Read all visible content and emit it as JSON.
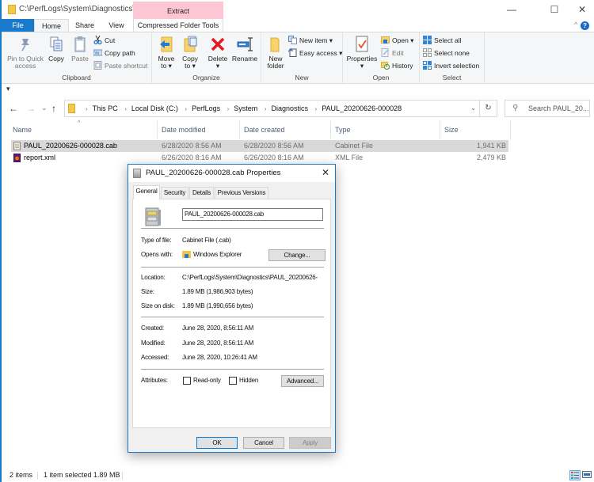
{
  "window": {
    "title": "C:\\PerfLogs\\System\\Diagnostics\\...",
    "contextual_tab_header": "Extract",
    "controls": {
      "minimize": "—",
      "maximize": "☐",
      "close": "✕"
    }
  },
  "ribbon_tabs": [
    "File",
    "Home",
    "Share",
    "View",
    "Compressed Folder Tools"
  ],
  "ribbon_controls": {
    "collapse": "^",
    "help": "?"
  },
  "ribbon": {
    "clipboard": {
      "label": "Clipboard",
      "pin": "Pin to Quick",
      "pin2": "access",
      "copy": "Copy",
      "paste": "Paste",
      "cut": "Cut",
      "copy_path": "Copy path",
      "paste_shortcut": "Paste shortcut"
    },
    "organize": {
      "label": "Organize",
      "move_to": "Move",
      "move_to2": "to ▾",
      "copy_to": "Copy",
      "copy_to2": "to ▾",
      "delete": "Delete",
      "delete2": "▾",
      "rename": "Rename"
    },
    "new": {
      "label": "New",
      "new_folder": "New",
      "new_folder2": "folder",
      "new_item": "New item ▾",
      "easy_access": "Easy access ▾"
    },
    "open": {
      "label": "Open",
      "properties": "Properties",
      "properties2": "▾",
      "open": "Open ▾",
      "edit": "Edit",
      "history": "History"
    },
    "select": {
      "label": "Select",
      "select_all": "Select all",
      "select_none": "Select none",
      "invert": "Invert selection"
    }
  },
  "qat": {
    "customize": "▾"
  },
  "nav": {
    "back": "←",
    "forward": "→",
    "recent": "⌄",
    "up": "↑",
    "breadcrumbs": [
      "This PC",
      "Local Disk (C:)",
      "PerfLogs",
      "System",
      "Diagnostics",
      "PAUL_20200626-000028"
    ],
    "separator": "›",
    "dropdown": "⌄",
    "refresh": "↻",
    "search_placeholder": "Search PAUL_20...",
    "search_icon": "⚲"
  },
  "file_list": {
    "sort_indicator": "^",
    "columns": [
      "Name",
      "Date modified",
      "Date created",
      "Type",
      "Size"
    ],
    "rows": [
      {
        "name": "PAUL_20200626-000028.cab",
        "modified": "6/28/2020 8:56 AM",
        "created": "6/28/2020 8:56 AM",
        "type": "Cabinet File",
        "size": "1,941 KB",
        "selected": true
      },
      {
        "name": "report.xml",
        "modified": "6/26/2020 8:16 AM",
        "created": "6/26/2020 8:16 AM",
        "type": "XML File",
        "size": "2,479 KB",
        "selected": false
      }
    ]
  },
  "status_bar": {
    "item_count": "2 items",
    "selection": "1 item selected  1.89 MB"
  },
  "properties_dialog": {
    "title": "PAUL_20200626-000028.cab Properties",
    "close": "✕",
    "tabs": [
      "General",
      "Security",
      "Details",
      "Previous Versions"
    ],
    "active_tab": "General",
    "file_name": "PAUL_20200626-000028.cab",
    "fields": {
      "type_label": "Type of file:",
      "type_value": "Cabinet File (.cab)",
      "opens_label": "Opens with:",
      "opens_value": "Windows Explorer",
      "change_button": "Change...",
      "location_label": "Location:",
      "location_value": "C:\\PerfLogs\\System\\Diagnostics\\PAUL_20200626-",
      "size_label": "Size:",
      "size_value": "1.89 MB (1,986,903 bytes)",
      "size_on_disk_label": "Size on disk:",
      "size_on_disk_value": "1.89 MB (1,990,656 bytes)",
      "created_label": "Created:",
      "created_value": "June 28, 2020, 8:56:11 AM",
      "modified_label": "Modified:",
      "modified_value": "June 28, 2020, 8:56:11 AM",
      "accessed_label": "Accessed:",
      "accessed_value": "June 28, 2020, 10:26:41 AM",
      "attributes_label": "Attributes:",
      "readonly_label": "Read-only",
      "readonly_checked": false,
      "hidden_label": "Hidden",
      "hidden_checked": false,
      "advanced_button": "Advanced..."
    },
    "buttons": {
      "ok": "OK",
      "cancel": "Cancel",
      "apply": "Apply"
    }
  },
  "colors": {
    "accent": "#1979ca",
    "contextual_tab": "#fcc6d4",
    "selected_row": "#d9d9d9",
    "dialog_bg": "#f0f0f0"
  }
}
